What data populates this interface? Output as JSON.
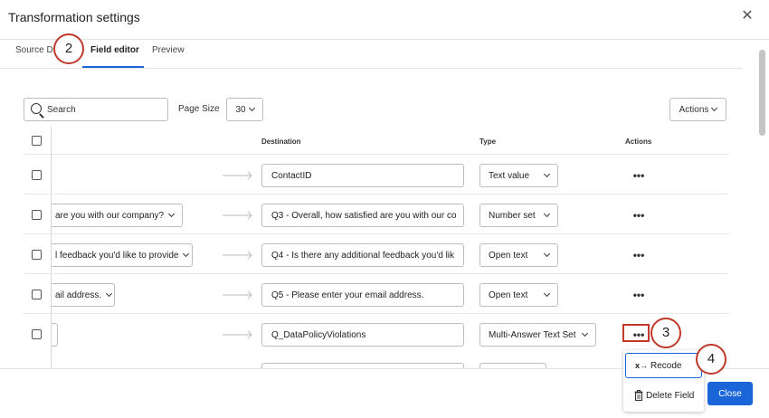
{
  "modal": {
    "title": "Transformation settings"
  },
  "tabs": [
    {
      "label": "Source D"
    },
    {
      "label": "Field editor"
    },
    {
      "label": "Preview"
    }
  ],
  "steps": {
    "s2": "2",
    "s3": "3",
    "s4": "4"
  },
  "toolbar": {
    "search_placeholder": "Search",
    "page_size_label": "Page Size",
    "page_size_value": "30",
    "actions_label": "Actions"
  },
  "columns": {
    "destination": "Destination",
    "type": "Type",
    "actions": "Actions"
  },
  "rows": [
    {
      "source": "",
      "destination": "ContactID",
      "type": "Text value"
    },
    {
      "source": "are you with our company?",
      "destination": "Q3 - Overall, how satisfied are you with our co",
      "type": "Number set"
    },
    {
      "source": "l feedback you'd like to provide",
      "destination": "Q4 - Is there any additional feedback you'd lik",
      "type": "Open text"
    },
    {
      "source": "ail address.",
      "destination": "Q5 - Please enter your email address.",
      "type": "Open text"
    },
    {
      "source": "",
      "destination": "Q_DataPolicyViolations",
      "type": "Multi-Answer Text Set"
    }
  ],
  "row_actions_glyph": "•••",
  "menu": {
    "recode_icon": "x→",
    "recode": "Recode",
    "delete": "Delete Field"
  },
  "footer": {
    "close_label": "Close"
  },
  "icons": {
    "close": "close-icon",
    "search": "search-icon",
    "chevron": "chevron-down-icon",
    "arrow": "arrow-right-icon",
    "trash": "trash-icon",
    "recode": "recode-icon"
  },
  "colors": {
    "accent": "#1a66d9",
    "annotation": "#c0392b"
  }
}
